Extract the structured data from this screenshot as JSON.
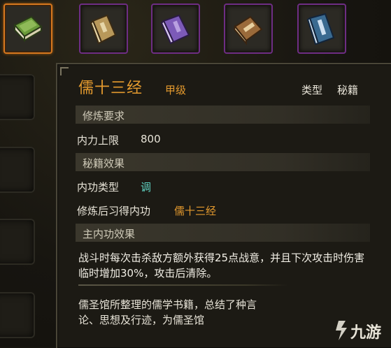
{
  "item_slots": [
    {
      "name": "green-book-icon",
      "active": true,
      "cover": "#6a9a3a",
      "accent": "#c8d89a"
    },
    {
      "name": "tan-book-icon",
      "active": false,
      "cover": "#b8985a",
      "accent": "#e6d6a8"
    },
    {
      "name": "purple-book-icon",
      "active": false,
      "cover": "#7c5ab8",
      "accent": "#d8c8f0"
    },
    {
      "name": "brown-book-icon",
      "active": false,
      "cover": "#9a6a3a",
      "accent": "#e8d0a0"
    },
    {
      "name": "blue-book-icon",
      "active": false,
      "cover": "#3a6a90",
      "accent": "#cfe0f0"
    }
  ],
  "tooltip": {
    "title": "儒十三经",
    "grade": "甲级",
    "type_label": "类型",
    "type_value": "秘籍",
    "sections": {
      "requirements": "修炼要求",
      "effects": "秘籍效果",
      "main_effect": "主内功效果"
    },
    "rows": {
      "neili_label": "内力上限",
      "neili_value": "800",
      "neigong_type_label": "内功类型",
      "neigong_type_value": "调",
      "learned_label": "修炼后习得内功",
      "learned_value": "儒十三经"
    },
    "description": "战斗时每次击杀敌方额外获得25点战意，并且下次攻击时伤害临时增加30%，攻击后清除。",
    "lore": "儒圣馆所整理的儒学书籍，总结了种言论、思想及行迹，为儒圣馆"
  },
  "watermark": {
    "text": "九游"
  },
  "colors": {
    "accent_orange": "#e49a2e",
    "accent_teal": "#5fd3c2",
    "slot_border": "#6e2d84",
    "slot_active": "#d6771e"
  }
}
